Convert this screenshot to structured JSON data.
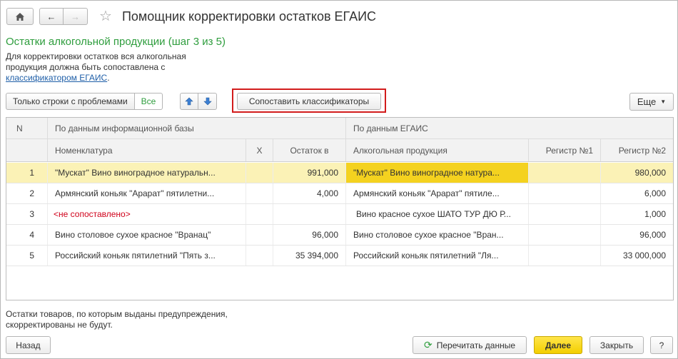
{
  "header": {
    "title": "Помощник корректировки остатков ЕГАИС"
  },
  "step_title": "Остатки алкогольной продукции (шаг 3 из 5)",
  "description": {
    "line1": "Для корректировки остатков вся алкогольная",
    "line2": "продукция должна быть сопоставлена с",
    "link": "классификатором ЕГАИС",
    "link_suffix": "."
  },
  "toolbar": {
    "filter_problems": "Только строки с проблемами",
    "filter_all": "Все",
    "match_classifiers": "Сопоставить классификаторы",
    "more": "Еще"
  },
  "table": {
    "group_headers": {
      "n": "N",
      "infobase": "По данным информационной базы",
      "egais": "По данным ЕГАИС"
    },
    "columns": {
      "nomenclature": "Номенклатура",
      "x": "X",
      "balance": "Остаток в",
      "alco_product": "Алкогольная продукция",
      "register1": "Регистр №1",
      "register2": "Регистр №2"
    },
    "rows": [
      {
        "n": "1",
        "nomenclature": "\"Мускат\" Вино виноградное натуральн...",
        "balance": "991,000",
        "product": "\"Мускат\" Вино виноградное натура...",
        "reg1": "",
        "reg2": "980,000"
      },
      {
        "n": "2",
        "nomenclature": "Армянский коньяк \"Арарат\" пятилетни...",
        "balance": "4,000",
        "product": "Армянский коньяк \"Арарат\" пятиле...",
        "reg1": "",
        "reg2": "6,000"
      },
      {
        "n": "3",
        "nomenclature": "<не сопоставлено>",
        "balance": "",
        "product": "Вино красное сухое ШАТО ТУР ДЮ Р...",
        "reg1": "",
        "reg2": "1,000"
      },
      {
        "n": "4",
        "nomenclature": "Вино столовое сухое красное \"Вранац\"",
        "balance": "96,000",
        "product": "Вино столовое сухое красное \"Вран...",
        "reg1": "",
        "reg2": "96,000"
      },
      {
        "n": "5",
        "nomenclature": "Российский коньяк пятилетний \"Пять з...",
        "balance": "35 394,000",
        "product": "Российский коньяк пятилетний \"Ля...",
        "reg1": "",
        "reg2": "33 000,000"
      }
    ]
  },
  "note": {
    "line1": "Остатки товаров, по которым выданы предупреждения,",
    "line2": "скорректированы не будут."
  },
  "footer": {
    "back": "Назад",
    "reread": "Перечитать данные",
    "next": "Далее",
    "close": "Закрыть",
    "help": "?"
  },
  "colors": {
    "accent_green": "#2e9d3d",
    "highlight_red": "#d21c1c",
    "selected_row": "#fbf2b6",
    "current_cell": "#f4d21f",
    "primary_button": "#f3cf00"
  }
}
